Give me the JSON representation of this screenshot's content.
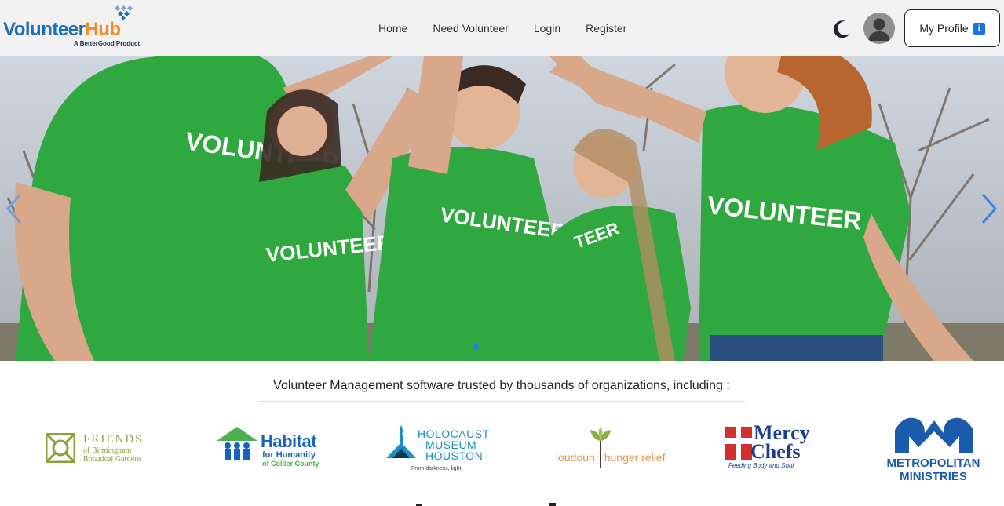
{
  "brand": {
    "name_part1": "Volunteer",
    "name_part2": "Hub",
    "tagline": "A BetterGood Product",
    "colors": {
      "blue": "#1d6fb5",
      "orange": "#f28c28"
    }
  },
  "nav": {
    "links": [
      {
        "label": "Home"
      },
      {
        "label": "Need Volunteer"
      },
      {
        "label": "Login"
      },
      {
        "label": "Register"
      }
    ],
    "theme_toggle_icon": "moon-icon",
    "avatar_icon": "user-avatar-icon",
    "profile_button": {
      "label": "My Profile",
      "badge": "i"
    }
  },
  "hero": {
    "slide_shirt_text": "VOLUNTEER",
    "prev_icon": "chevron-left-icon",
    "next_icon": "chevron-right-icon",
    "active_slide": 1,
    "slide_count": 1
  },
  "trusted": {
    "heading": "Volunteer Management software trusted by thousands of organizations, including :"
  },
  "organizations": [
    {
      "line1": "FRIENDS",
      "line2": "of Birmingham",
      "line3": "Botanical Gardens"
    },
    {
      "line1": "Habitat",
      "line2": "for Humanity",
      "line3": "of Collier County"
    },
    {
      "line1": "HOLOCAUST",
      "line2": "MUSEUM",
      "line3": "HOUSTON",
      "line4": "From darkness, light."
    },
    {
      "line1": "loudoun",
      "line2": "hunger relief"
    },
    {
      "line1": "Mercy",
      "line2": "Chefs",
      "line3": "Feeding Body and Soul"
    },
    {
      "line1": "METROPOLITAN",
      "line2": "MINISTRIES"
    }
  ]
}
